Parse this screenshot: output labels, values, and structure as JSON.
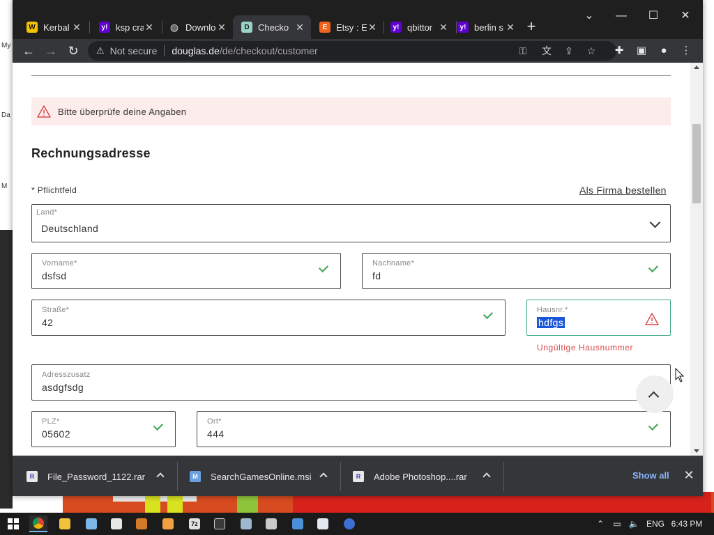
{
  "browser": {
    "tabs": [
      {
        "title": "Kerbal",
        "icon": "kerbal-favicon",
        "color": "#f2c200",
        "active": false
      },
      {
        "title": "ksp cra",
        "icon": "yahoo-favicon",
        "color": "#5f01d1",
        "active": false
      },
      {
        "title": "Downlo",
        "icon": "globe-favicon",
        "color": "#5c6066",
        "active": false
      },
      {
        "title": "Checko",
        "icon": "douglas-favicon",
        "color": "#9bd2c8",
        "active": true
      },
      {
        "title": "Etsy : E",
        "icon": "etsy-favicon",
        "color": "#f1641e",
        "active": false
      },
      {
        "title": "qbittor",
        "icon": "yahoo-favicon",
        "color": "#5f01d1",
        "active": false
      },
      {
        "title": "berlin s",
        "icon": "yahoo-favicon",
        "color": "#5f01d1",
        "active": false
      }
    ],
    "new_tab_icon": "+",
    "window_controls": {
      "menu": "⌄",
      "minimize": "—",
      "maximize": "☐",
      "close": "✕"
    },
    "address": {
      "security_label": "Not secure",
      "host": "douglas.de",
      "path": "/de/checkout/customer"
    }
  },
  "page": {
    "error_banner": "Bitte überprüfe deine Angaben",
    "section_title": "Rechnungsadresse",
    "required_note": "* Pflichtfeld",
    "company_link": "Als Firma bestellen",
    "fields": {
      "country": {
        "label": "Land*",
        "value": "Deutschland"
      },
      "first_name": {
        "label": "Vorname*",
        "value": "dsfsd"
      },
      "last_name": {
        "label": "Nachname*",
        "value": "fd"
      },
      "street": {
        "label": "Straße*",
        "value": "42"
      },
      "house_number": {
        "label": "Hausnr.*",
        "value": "hdfgs",
        "error": "Ungültige Hausnummer"
      },
      "address_extra": {
        "label": "Adresszusatz",
        "value": "asdgfsdg"
      },
      "postal_code": {
        "label": "PLZ*",
        "value": "05602"
      },
      "city": {
        "label": "Ort*",
        "value": "444"
      }
    },
    "colors": {
      "valid": "#3aa655",
      "error": "#d94c4c",
      "error_bg": "#fdecec"
    }
  },
  "downloads": {
    "items": [
      {
        "name": "File_Password_1122.rar",
        "icon": "rar-icon"
      },
      {
        "name": "SearchGamesOnline.msi",
        "icon": "msi-installer-icon"
      },
      {
        "name": "Adobe Photoshop....rar",
        "icon": "rar-icon"
      }
    ],
    "show_all": "Show all"
  },
  "taskbar": {
    "language": "ENG",
    "time": "6:43 PM"
  },
  "desktop": {
    "labels": [
      "My",
      "Da",
      "M"
    ]
  }
}
